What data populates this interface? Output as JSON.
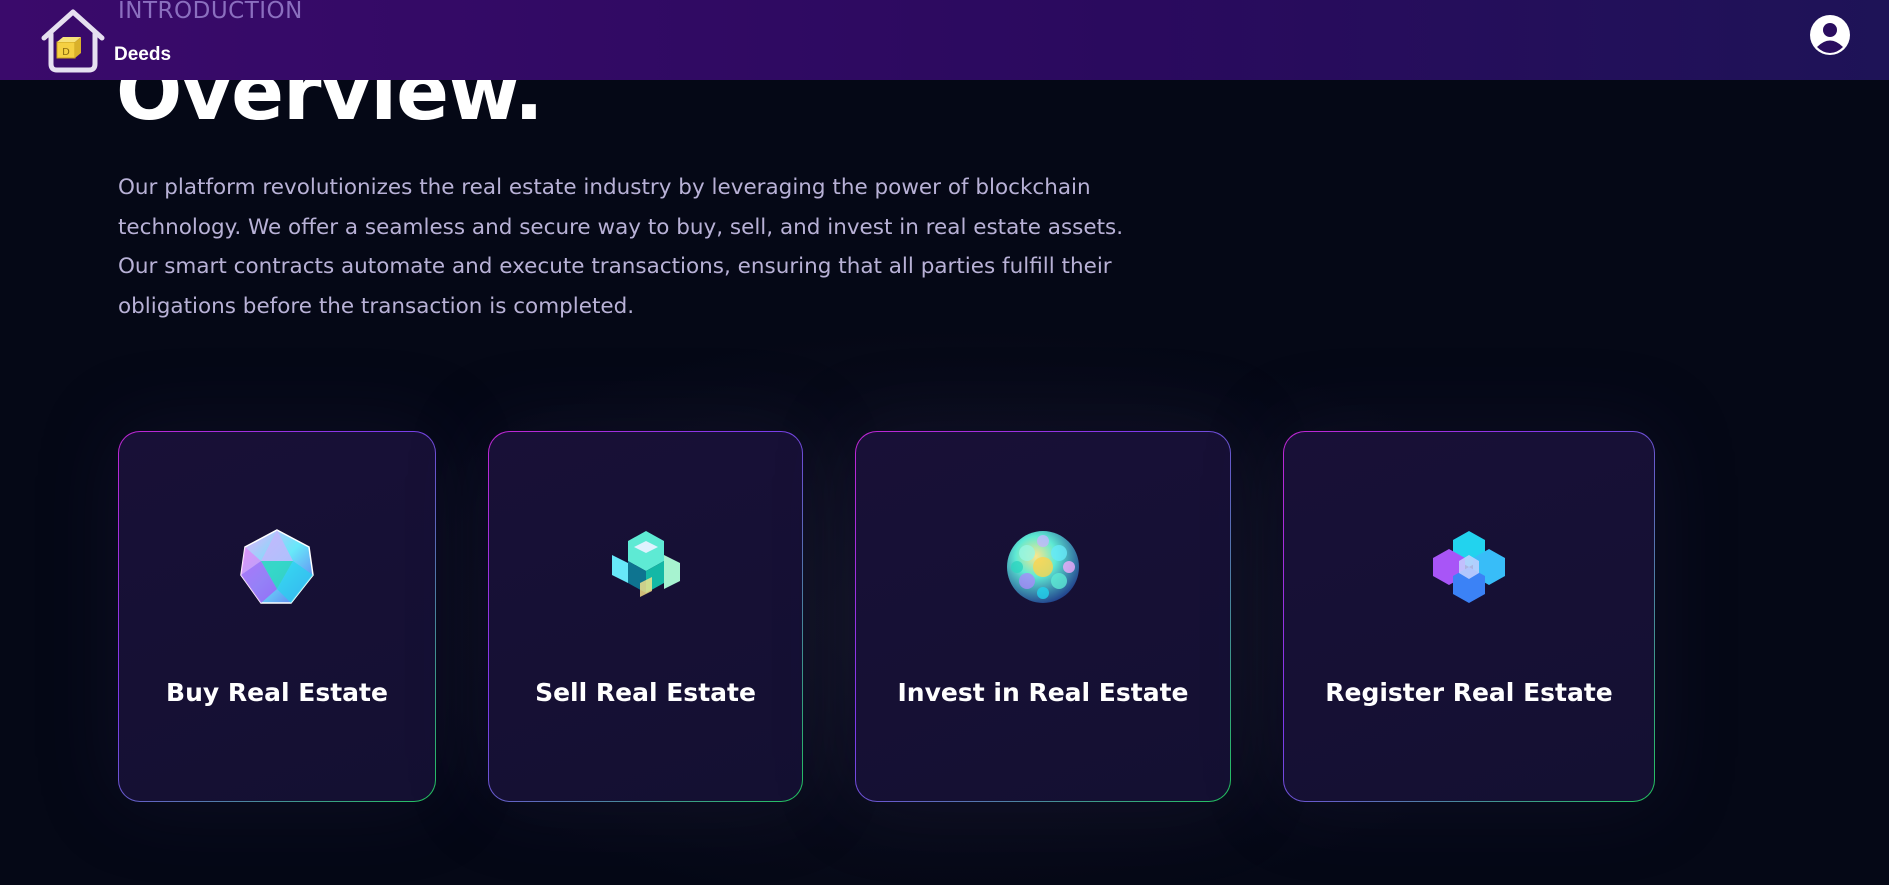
{
  "header": {
    "subtitle": "INTRODUCTION",
    "brand": "Deeds",
    "logo_icon": "house-icon",
    "profile_icon": "user-circle-icon",
    "bg_colors": [
      "#3a0a6b",
      "#1e1357"
    ]
  },
  "hero": {
    "title": "Overview.",
    "description": "Our platform revolutionizes the real estate industry by leveraging the power of blockchain technology. We offer a seamless and secure way to buy, sell, and invest in real estate assets. Our smart contracts automate and execute transactions, ensuring that all parties fulfill their obligations before the transaction is completed."
  },
  "cards": [
    {
      "label": "Buy Real Estate",
      "icon": "icosahedron-icon"
    },
    {
      "label": "Sell Real Estate",
      "icon": "cube-cluster-icon"
    },
    {
      "label": "Invest in Real Estate",
      "icon": "sphere-icon"
    },
    {
      "label": "Register Real Estate",
      "icon": "hexagon-cluster-icon"
    }
  ],
  "colors": {
    "background": "#050816",
    "card_bg": "#161035",
    "border_start": "#c026d3",
    "border_end": "#22c55e",
    "text": "#ffffff",
    "muted_text": "#b8b1d6"
  }
}
